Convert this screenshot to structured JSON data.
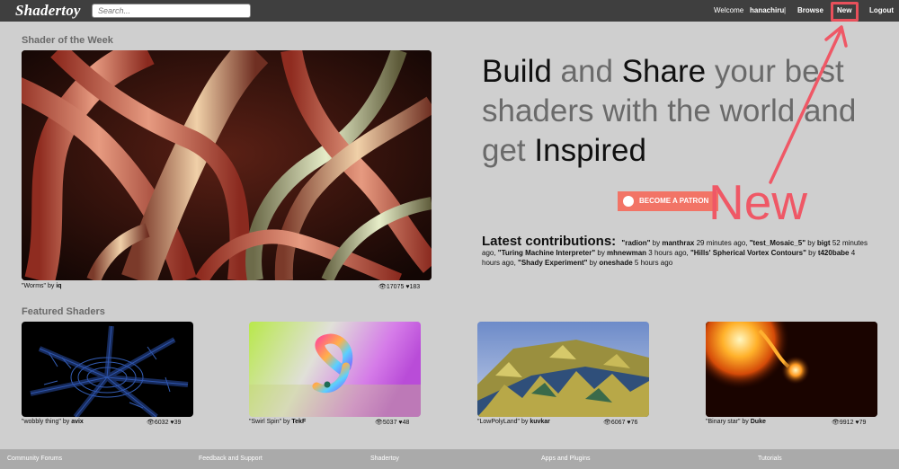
{
  "header": {
    "logo": "Shadertoy",
    "search_placeholder": "Search...",
    "welcome": "Welcome",
    "username": "hanachiru",
    "separator": "|",
    "browse": "Browse",
    "new": "New",
    "logout": "Logout"
  },
  "shader_of_week": {
    "title": "Shader of the Week",
    "name": "\"Worms\"",
    "by": "by",
    "author": "iq",
    "views": "17075",
    "likes": "183"
  },
  "hero": {
    "w1": "Build",
    "w2": " and ",
    "w3": "Share",
    "w4": " your best shaders with the world and get ",
    "w5": "Inspired"
  },
  "patreon": {
    "label": "BECOME A PATRON"
  },
  "latest": {
    "title": "Latest contributions:",
    "items": [
      {
        "name": "\"radion\"",
        "by": " by ",
        "author": "manthrax",
        "when": " 29 minutes ago, "
      },
      {
        "name": "\"test_Mosaic_5\"",
        "by": " by ",
        "author": "bigt",
        "when": " 52 minutes ago, "
      },
      {
        "name": "\"Turing Machine Interpreter\"",
        "by": " by ",
        "author": "mhnewman",
        "when": " 3 hours ago, "
      },
      {
        "name": "\"Hills' Spherical Vortex Contours\"",
        "by": " by ",
        "author": "t420babe",
        "when": " 4 hours ago, "
      },
      {
        "name": "\"Shady Experiment\"",
        "by": " by ",
        "author": "oneshade",
        "when": " 5 hours ago"
      }
    ]
  },
  "annotation": {
    "text": "New"
  },
  "featured": {
    "title": "Featured Shaders",
    "items": [
      {
        "name": "\"wobbly thing\"",
        "by": "by",
        "author": "avix",
        "views": "6032",
        "likes": "39"
      },
      {
        "name": "\"Swirl Spin\"",
        "by": "by",
        "author": "TekF",
        "views": "5037",
        "likes": "48"
      },
      {
        "name": "\"LowPolyLand\"",
        "by": "by",
        "author": "kuvkar",
        "views": "6067",
        "likes": "76"
      },
      {
        "name": "\"Binary star\"",
        "by": "by",
        "author": "Duke",
        "views": "9912",
        "likes": "79"
      }
    ]
  },
  "footer": {
    "links": [
      "Community Forums",
      "Feedback and Support",
      "Shadertoy",
      "Apps and Plugins",
      "Tutorials"
    ]
  },
  "colors": {
    "topbar": "#3f3f3f",
    "accent": "#ef5866",
    "patreon": "#f27466",
    "footer": "#aaaaaa"
  },
  "icons": [
    "eye-icon",
    "heart-icon",
    "patreon-icon"
  ]
}
